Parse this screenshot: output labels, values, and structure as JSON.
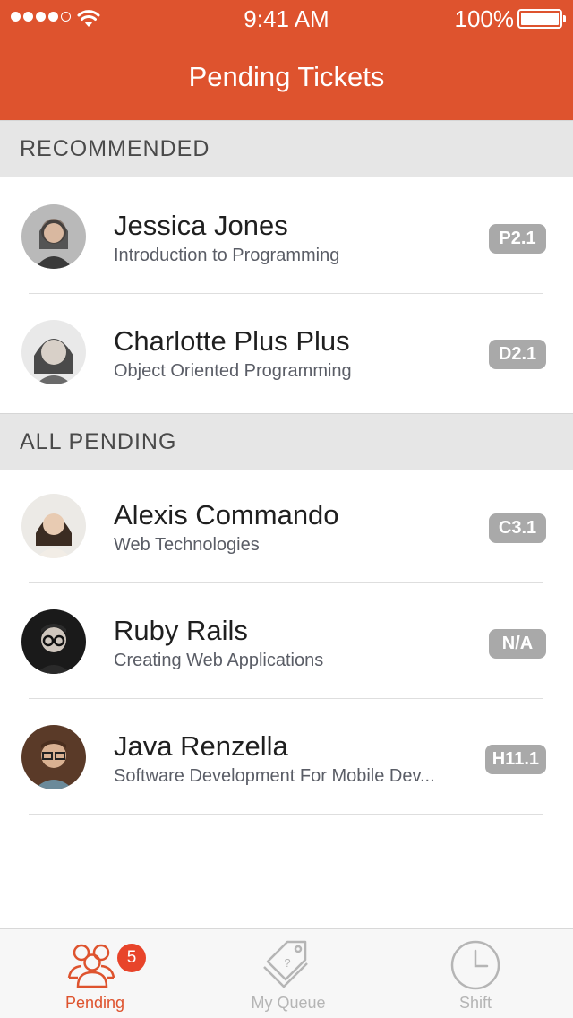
{
  "status_bar": {
    "time": "9:41 AM",
    "battery": "100%"
  },
  "header": {
    "title": "Pending Tickets"
  },
  "sections": [
    {
      "label": "RECOMMENDED",
      "items": [
        {
          "name": "Jessica Jones",
          "course": "Introduction to Programming",
          "badge": "P2.1"
        },
        {
          "name": "Charlotte Plus Plus",
          "course": "Object Oriented Programming",
          "badge": "D2.1"
        }
      ]
    },
    {
      "label": "ALL PENDING",
      "items": [
        {
          "name": "Alexis Commando",
          "course": "Web Technologies",
          "badge": "C3.1"
        },
        {
          "name": "Ruby Rails",
          "course": "Creating Web Applications",
          "badge": "N/A"
        },
        {
          "name": "Java Renzella",
          "course": "Software Development For Mobile Dev...",
          "badge": "H11.1"
        }
      ]
    }
  ],
  "tabbar": {
    "tabs": [
      {
        "label": "Pending",
        "icon": "people-icon",
        "badge": "5",
        "active": true
      },
      {
        "label": "My Queue",
        "icon": "tags-icon",
        "active": false
      },
      {
        "label": "Shift",
        "icon": "clock-icon",
        "active": false
      }
    ]
  },
  "colors": {
    "accent": "#DE532E",
    "badge_bg": "#A9A9A9",
    "tab_inactive": "#B5B5B5",
    "notification": "#E8442A"
  }
}
